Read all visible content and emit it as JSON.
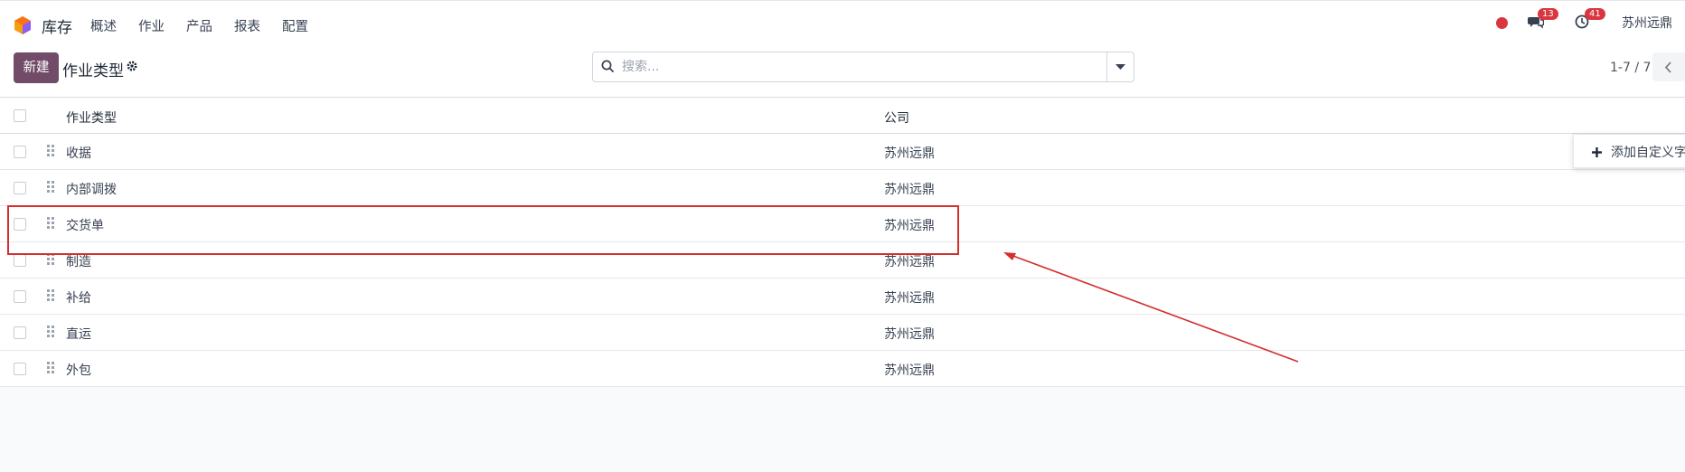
{
  "nav": {
    "app_name": "库存",
    "menu": [
      "概述",
      "作业",
      "产品",
      "报表",
      "配置"
    ],
    "messages_badge": "13",
    "activities_badge": "41",
    "company": "苏州远鼎"
  },
  "control": {
    "new_label": "新建",
    "title": "作业类型",
    "search_placeholder": "搜索...",
    "pager": "1-7 / 7"
  },
  "table": {
    "headers": [
      "作业类型",
      "公司"
    ],
    "rows": [
      {
        "name": "收据",
        "company": "苏州远鼎"
      },
      {
        "name": "内部调拨",
        "company": "苏州远鼎"
      },
      {
        "name": "交货单",
        "company": "苏州远鼎"
      },
      {
        "name": "制造",
        "company": "苏州远鼎"
      },
      {
        "name": "补给",
        "company": "苏州远鼎"
      },
      {
        "name": "直运",
        "company": "苏州远鼎"
      },
      {
        "name": "外包",
        "company": "苏州远鼎"
      }
    ]
  },
  "popup": {
    "label": "添加自定义字"
  },
  "colors": {
    "brand": "#714b67",
    "badge": "#d9363e",
    "annotation": "#d32f2f"
  }
}
